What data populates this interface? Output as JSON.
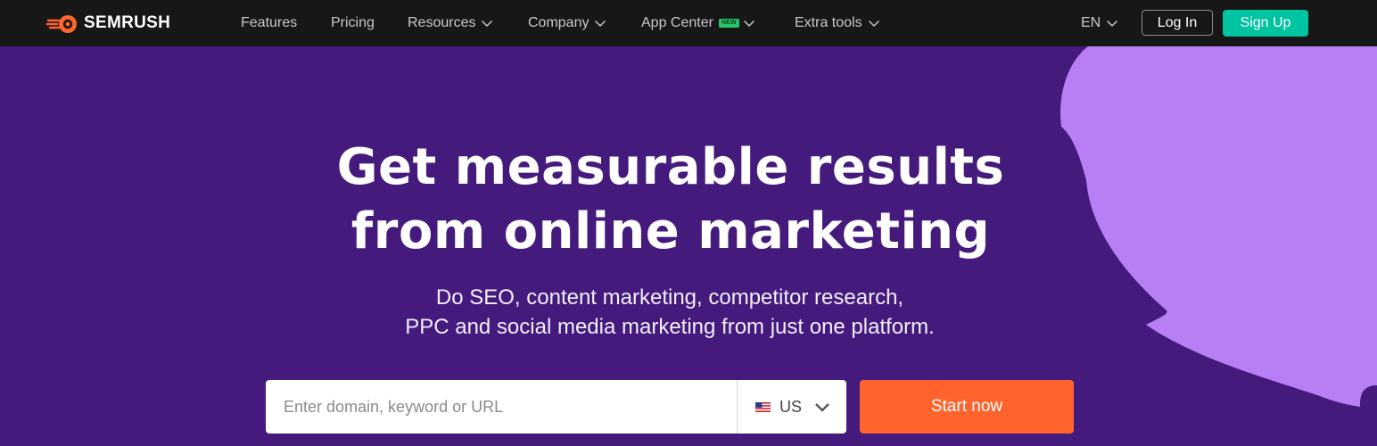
{
  "brand": {
    "name": "SEMRUSH",
    "logo_icon": "fire-ball-icon",
    "logo_color": "#ff642d"
  },
  "nav": {
    "items": [
      {
        "label": "Features",
        "dropdown": false
      },
      {
        "label": "Pricing",
        "dropdown": false
      },
      {
        "label": "Resources",
        "dropdown": true
      },
      {
        "label": "Company",
        "dropdown": true
      },
      {
        "label": "App Center",
        "dropdown": true,
        "badge": "NEW"
      },
      {
        "label": "Extra tools",
        "dropdown": true
      }
    ],
    "language": "EN",
    "login_label": "Log In",
    "signup_label": "Sign Up"
  },
  "hero": {
    "title_line1": "Get measurable results",
    "title_line2": "from online marketing",
    "subtitle_line1": "Do SEO, content marketing, competitor research,",
    "subtitle_line2": "PPC and social media marketing from just one platform.",
    "search_placeholder": "Enter domain, keyword or URL",
    "database_value": "US",
    "database_icon": "us-flag-icon",
    "cta_label": "Start now"
  },
  "colors": {
    "nav_bg": "#171717",
    "hero_bg": "#441a7d",
    "decor_purple": "#b87ff5",
    "signup_green": "#00c3a0",
    "cta_orange": "#ff642d"
  }
}
